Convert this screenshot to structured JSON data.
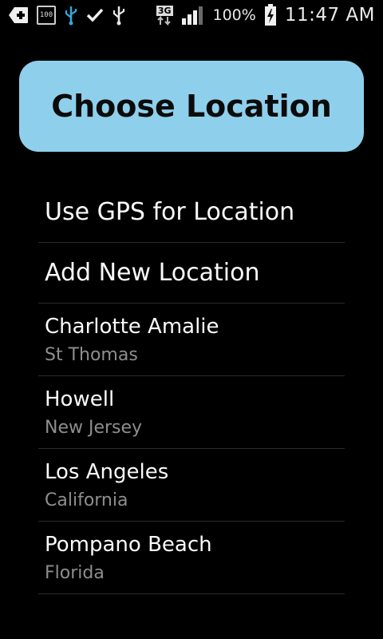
{
  "status_bar": {
    "icons": [
      "add-icon",
      "battery-100-icon",
      "usb-debug-icon",
      "check-icon",
      "usb-icon",
      "network-3g-icon",
      "signal-icon",
      "battery-charging-icon"
    ],
    "battery_small_label": "100",
    "network_label": "3G",
    "battery_percent": "100%",
    "time": "11:47 AM"
  },
  "header": {
    "title": "Choose Location",
    "background": "#8ed0ec"
  },
  "actions": [
    {
      "label": "Use GPS for Location"
    },
    {
      "label": "Add New Location"
    }
  ],
  "locations": [
    {
      "city": "Charlotte Amalie",
      "region": "St Thomas"
    },
    {
      "city": "Howell",
      "region": "New Jersey"
    },
    {
      "city": "Los Angeles",
      "region": "California"
    },
    {
      "city": "Pompano Beach",
      "region": "Florida"
    }
  ]
}
